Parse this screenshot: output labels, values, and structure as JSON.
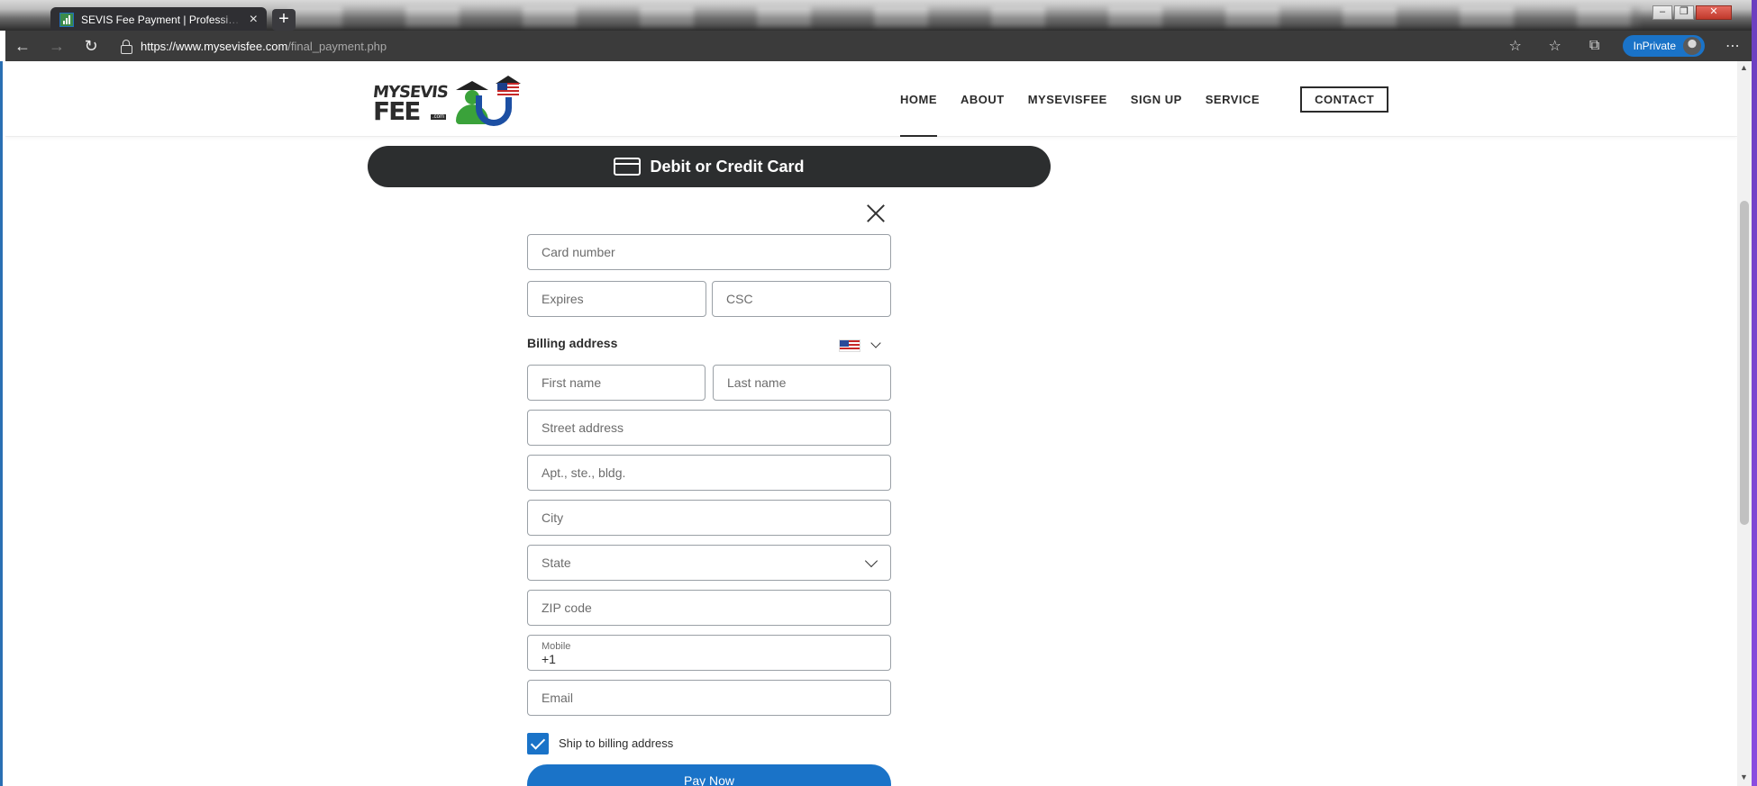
{
  "browser": {
    "tab_title": "SEVIS Fee Payment | Professiona",
    "tab_close": "×",
    "new_tab": "+",
    "url_host": "https://www.mysevisfee.com",
    "url_path": "/final_payment.php",
    "inprivate_label": "InPrivate",
    "window_controls": {
      "minimize": "–",
      "restore": "❐",
      "close": "✕"
    },
    "icons": {
      "back": "←",
      "forward": "→",
      "reload": "↻",
      "add_favorite": "☆",
      "favorites": "☆",
      "collections": "⧉",
      "more": "⋯"
    }
  },
  "site": {
    "logo": {
      "line1": "MYSEVIS",
      "line2": "FEE",
      "com": ".com"
    },
    "nav": [
      "HOME",
      "ABOUT",
      "MYSEVISFEE",
      "SIGN UP",
      "SERVICE",
      "CONTACT"
    ],
    "active_nav": "HOME"
  },
  "payment": {
    "banner_label": "Debit or Credit Card",
    "fields": {
      "card_number": "Card number",
      "expires": "Expires",
      "csc": "CSC",
      "first_name": "First name",
      "last_name": "Last name",
      "street": "Street address",
      "apt": "Apt., ste., bldg.",
      "city": "City",
      "state": "State",
      "zip": "ZIP code",
      "mobile_label": "Mobile",
      "mobile_value": "+1",
      "email": "Email"
    },
    "billing_label": "Billing address",
    "ship_label": "Ship to billing address",
    "ship_checked": true,
    "pay_button": "Pay Now"
  },
  "colors": {
    "primary_blue": "#1a73c8",
    "banner_dark": "#2c2e2f",
    "browser_toolbar": "#3b3b3b"
  }
}
